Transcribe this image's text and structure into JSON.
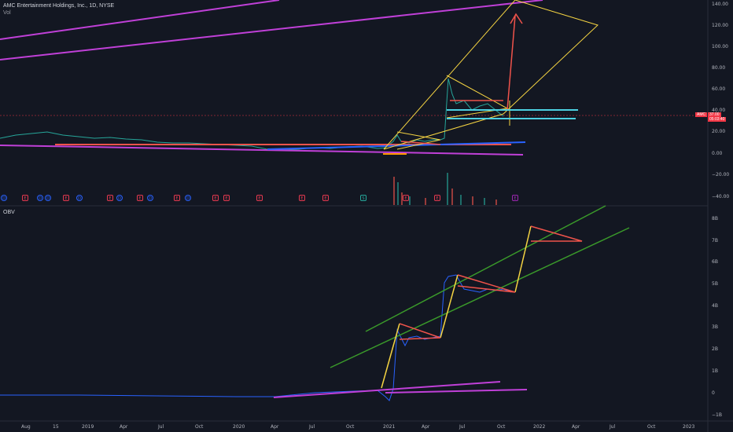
{
  "chart": {
    "symbol_title": "AMC Entertainment Holdings, Inc., 1D, NYSE",
    "volume_label": "Vol",
    "obv_label": "OBV",
    "ticker_badge": "AMC",
    "last_price": "37.00",
    "countdown": "05:03:40",
    "top_cutoff_label": "140.00"
  },
  "price_axis": [
    "120.00",
    "100.00",
    "80.00",
    "60.00",
    "40.00",
    "20.00",
    "0.00",
    "−20.00",
    "−40.00"
  ],
  "obv_axis": [
    "8B",
    "7B",
    "6B",
    "5B",
    "4B",
    "3B",
    "2B",
    "1B",
    "0",
    "−1B"
  ],
  "time_axis": [
    "Aug",
    "15",
    "2019",
    "Apr",
    "Jul",
    "Oct",
    "2020",
    "Apr",
    "Jul",
    "Oct",
    "2021",
    "Apr",
    "Jul",
    "Oct",
    "2022",
    "Apr",
    "Jul",
    "Oct",
    "2023"
  ],
  "events": [
    "D",
    "E",
    "D",
    "D",
    "E",
    "D",
    "E",
    "D",
    "E",
    "D",
    "E",
    "D",
    "E",
    "E",
    "E",
    "E",
    "E",
    "S",
    "E",
    "E",
    "E"
  ],
  "colors": {
    "background": "#131722",
    "purple": "#c040d8",
    "yellow": "#f5d442",
    "red": "#f0534b",
    "green": "#3a9a2a",
    "cyan": "#4dd0e1",
    "blue": "#2962ff",
    "orange": "#ff9800",
    "badge": "#f23645"
  }
}
